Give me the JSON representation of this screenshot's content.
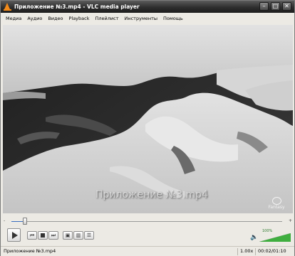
{
  "window": {
    "title": "Приложение №3.mp4 - VLC media player",
    "buttons": {
      "minimize": "–",
      "maximize": "□",
      "close": "✕"
    }
  },
  "menu": {
    "items": [
      "Медиа",
      "Аудио",
      "Видео",
      "Playback",
      "Плейлист",
      "Инструменты",
      "Помощь"
    ]
  },
  "video": {
    "overlay_title": "Приложение №3.mp4",
    "watermark": "Fantasy"
  },
  "controls": {
    "time_elapsed": "-",
    "time_remaining": "+",
    "seek_progress": 0.05,
    "volume_percent_label": "100%",
    "volume_level": 1.0,
    "icons": [
      "play-icon",
      "previous-icon",
      "stop-icon",
      "next-icon",
      "fullscreen-icon",
      "playlist-icon",
      "speaker-icon"
    ]
  },
  "statusbar": {
    "file_name": "Приложение №3.mp4",
    "speed": "1.00x",
    "time": "00:02/01:10"
  },
  "colors": {
    "titlebar": "#2e2e2e",
    "accent": "#3a6fc0",
    "volume_green": "#3fae3f"
  }
}
